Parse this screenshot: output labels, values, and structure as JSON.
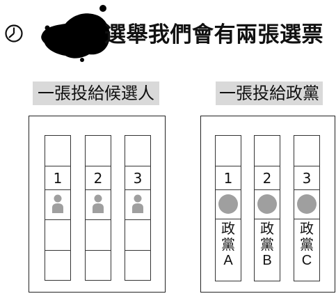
{
  "header": {
    "title": "選舉我們會有兩張選票",
    "icon": "clock-icon",
    "decoration": "ink-splat"
  },
  "candidate_ballot": {
    "label": "一張投給候選人",
    "columns": [
      {
        "number": "1",
        "icon": "person-icon"
      },
      {
        "number": "2",
        "icon": "person-icon"
      },
      {
        "number": "3",
        "icon": "person-icon"
      }
    ]
  },
  "party_ballot": {
    "label": "一張投給政黨",
    "columns": [
      {
        "number": "1",
        "icon": "circle-icon",
        "party_line1": "政",
        "party_line2": "黨",
        "party_letter": "A"
      },
      {
        "number": "2",
        "icon": "circle-icon",
        "party_line1": "政",
        "party_line2": "黨",
        "party_letter": "B"
      },
      {
        "number": "3",
        "icon": "circle-icon",
        "party_line1": "政",
        "party_line2": "黨",
        "party_letter": "C"
      }
    ]
  },
  "colors": {
    "label_bg": "#d9d9d9",
    "icon_gray": "#9f9f9f",
    "ink": "#111111"
  }
}
